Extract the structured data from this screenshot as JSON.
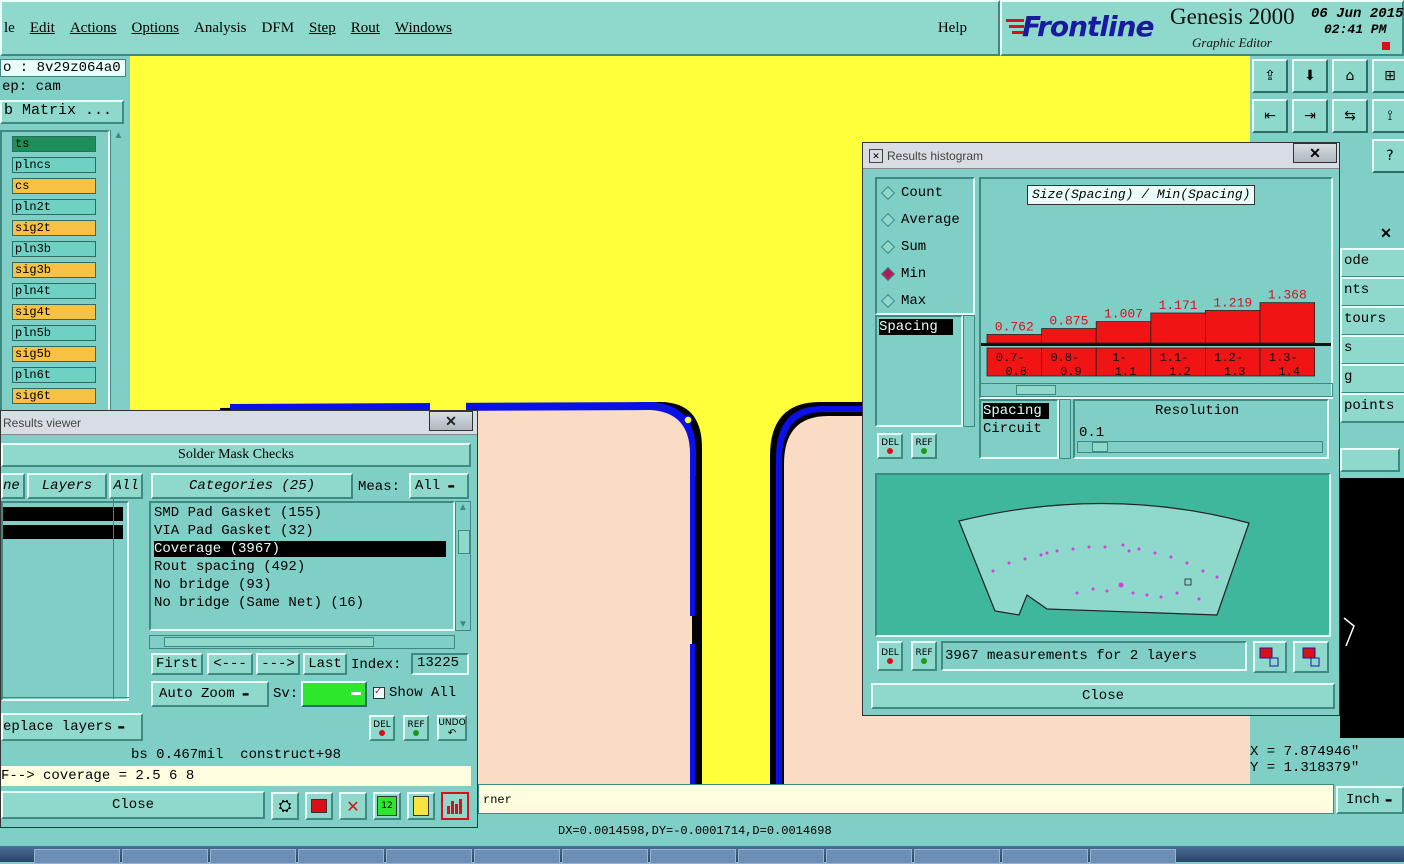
{
  "menu": {
    "items": [
      "le",
      "Edit",
      "Actions",
      "Options",
      "Analysis",
      "DFM",
      "Step",
      "Rout",
      "Windows"
    ],
    "help": "Help"
  },
  "brand": {
    "logo": "Frontline",
    "product": "Genesis 2000",
    "subtitle": "Graphic Editor",
    "date": "06 Jun 2015",
    "time": "02:41 PM"
  },
  "left_panel": {
    "job_line": "o : 8v29z064a0",
    "step_line": "ep: cam",
    "matrix_button": "b Matrix ...",
    "layers": [
      {
        "name": "ts",
        "color": "#1f8f5a"
      },
      {
        "name": "plncs",
        "color": "#6fd0c4"
      },
      {
        "name": "cs",
        "color": "#f7c244"
      },
      {
        "name": "pln2t",
        "color": "#6fd0c4"
      },
      {
        "name": "sig2t",
        "color": "#f7c244"
      },
      {
        "name": "pln3b",
        "color": "#6fd0c4"
      },
      {
        "name": "sig3b",
        "color": "#f7c244"
      },
      {
        "name": "pln4t",
        "color": "#6fd0c4"
      },
      {
        "name": "sig4t",
        "color": "#f7c244"
      },
      {
        "name": "pln5b",
        "color": "#6fd0c4"
      },
      {
        "name": "sig5b",
        "color": "#f7c244"
      },
      {
        "name": "pln6t",
        "color": "#6fd0c4"
      },
      {
        "name": "sig6t",
        "color": "#f7c244"
      }
    ]
  },
  "results_viewer": {
    "title": "Results viewer",
    "header": "Solder Mask Checks",
    "tab_partial": "ne",
    "tab_layers": "Layers",
    "tab_all": "All",
    "categories_label": "Categories (25)",
    "meas_label": "Meas:",
    "meas_value": "All",
    "categories": [
      "SMD Pad Gasket (155)",
      "VIA Pad Gasket (32)",
      "Coverage (3967)",
      "Rout spacing (492)",
      "No bridge (93)",
      "No bridge (Same Net) (16)"
    ],
    "selected_index": 2,
    "nav_first": "First",
    "nav_prev": "<---",
    "nav_next": "--->",
    "nav_last": "Last",
    "index_label": "Index:",
    "index_value": "13225",
    "auto_zoom": "Auto Zoom",
    "sv_label": "Sv:",
    "show_all": "Show All",
    "replace_layers": "eplace layers",
    "icon_del": "DEL",
    "icon_ref": "REF",
    "icon_undo": "UNDO",
    "info_line": "bs 0.467mil  construct+98",
    "formula_line": "F--> coverage = 2.5 6 8",
    "close": "Close"
  },
  "histogram": {
    "title": "Results histogram",
    "options": [
      {
        "label": "Count",
        "selected": false
      },
      {
        "label": "Average",
        "selected": false
      },
      {
        "label": "Sum",
        "selected": false
      },
      {
        "label": "Min",
        "selected": true
      },
      {
        "label": "Max",
        "selected": false
      }
    ],
    "measure_list": [
      "Spacing"
    ],
    "chart_title": "Size(Spacing) / Min(Spacing)",
    "bar_values": [
      "0.762",
      "0.875",
      "1.007",
      "1.171",
      "1.219",
      "1.368"
    ],
    "bar_ranges": [
      [
        "0.7-",
        "0.8"
      ],
      [
        "0.8-",
        "0.9"
      ],
      [
        "1-",
        "1.1"
      ],
      [
        "1.1-",
        "1.2"
      ],
      [
        "1.2-",
        "1.3"
      ],
      [
        "1.3-",
        "1.4"
      ]
    ],
    "group_list": [
      "Spacing",
      "Circuit"
    ],
    "resolution_label": "Resolution",
    "resolution_value": "0.1",
    "measurements_text": "3967 measurements for 2 layers",
    "close": "Close",
    "icon_del": "DEL",
    "icon_ref": "REF"
  },
  "right_panel": {
    "items": [
      "ode",
      "nts",
      "tours",
      "s",
      "g",
      "points"
    ],
    "x_readout": "X = 7.874946\"",
    "y_readout": "Y = 1.318379\"",
    "units": "Inch"
  },
  "status": {
    "message": "rner",
    "coords": "DX=0.0014598,DY=-0.0001714,D=0.0014698"
  },
  "chart_data": {
    "type": "bar",
    "title": "Size(Spacing) / Min(Spacing)",
    "categories": [
      "0.7-0.8",
      "0.8-0.9",
      "1-1.1",
      "1.1-1.2",
      "1.2-1.3",
      "1.3-1.4"
    ],
    "values": [
      0.762,
      0.875,
      1.007,
      1.171,
      1.219,
      1.368
    ],
    "xlabel": "",
    "ylabel": "",
    "color": "#f01414"
  },
  "colors": {
    "canvas": "#ffff3a",
    "pad": "#fadcc4",
    "outline": "#0a10e6",
    "panel": "#7fcfc6",
    "bar": "#f01414"
  }
}
